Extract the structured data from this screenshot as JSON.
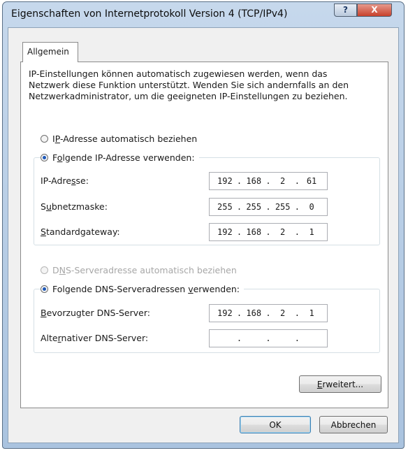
{
  "window": {
    "title": "Eigenschaften von Internetprotokoll Version 4 (TCP/IPv4)",
    "help_label": "?",
    "close_label": "X"
  },
  "tabs": [
    {
      "label": "Allgemein",
      "active": true
    }
  ],
  "intro_text": "IP-Einstellungen können automatisch zugewiesen werden, wenn das Netzwerk diese Funktion unterstützt. Wenden Sie sich andernfalls an den Netzwerkadministrator, um die geeigneten IP-Einstellungen zu beziehen.",
  "ip": {
    "auto": {
      "label_pre": "I",
      "label_key": "P",
      "label_post": "-Adresse automatisch beziehen",
      "checked": false
    },
    "manual": {
      "label_pre": "F",
      "label_key": "o",
      "label_post": "lgende IP-Adresse verwenden:",
      "checked": true
    },
    "fields": [
      {
        "label_pre": "IP-Adre",
        "label_key": "s",
        "label_post": "se:",
        "octets": [
          "192",
          "168",
          "2",
          "61"
        ]
      },
      {
        "label_pre": "S",
        "label_key": "u",
        "label_post": "bnetzmaske:",
        "octets": [
          "255",
          "255",
          "255",
          "0"
        ]
      },
      {
        "label_pre": "",
        "label_key": "S",
        "label_post": "tandardgateway:",
        "octets": [
          "192",
          "168",
          "2",
          "1"
        ]
      }
    ]
  },
  "dns": {
    "auto": {
      "label_pre": "D",
      "label_key": "N",
      "label_post": "S-Serveradresse automatisch beziehen",
      "checked": false,
      "disabled": true
    },
    "manual": {
      "label_pre": "Folgende DNS-Serveradressen ",
      "label_key": "v",
      "label_post": "erwenden:",
      "checked": true
    },
    "fields": [
      {
        "label_pre": "",
        "label_key": "B",
        "label_post": "evorzugter DNS-Server:",
        "octets": [
          "192",
          "168",
          "2",
          "1"
        ]
      },
      {
        "label_pre": "Alte",
        "label_key": "r",
        "label_post": "nativer DNS-Server:",
        "octets": [
          "",
          "",
          "",
          ""
        ]
      }
    ]
  },
  "buttons": {
    "advanced": {
      "label_pre": "",
      "label_key": "E",
      "label_post": "rweitert..."
    },
    "ok": "OK",
    "cancel": "Abbrechen"
  },
  "colors": {
    "title_bg": "#b4cae4",
    "close_button": "#c8412c",
    "radio_dot": "#1d58b8",
    "disabled_text": "#a7a7a7"
  }
}
